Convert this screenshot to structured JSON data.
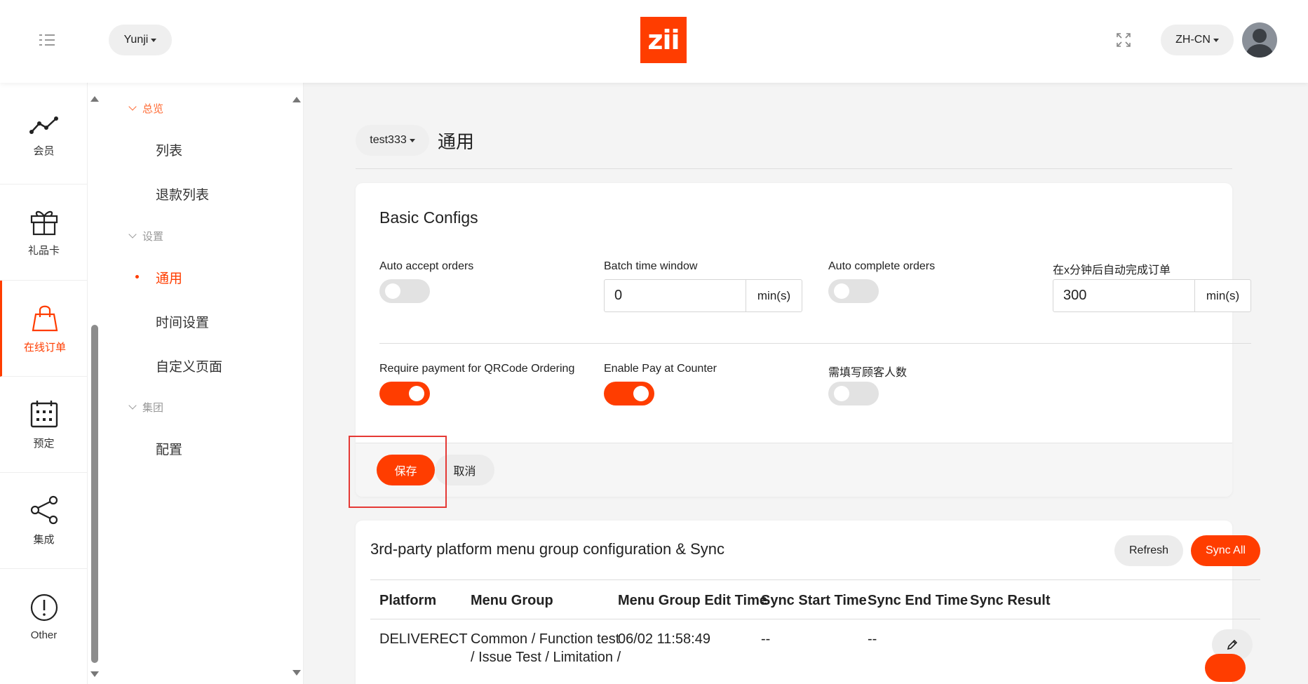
{
  "header": {
    "org_selector": "Yunji",
    "logo_text": "zii",
    "language": "ZH-CN"
  },
  "rail": {
    "items": [
      {
        "label": "会员",
        "icon": "trend-line-icon"
      },
      {
        "label": "礼品卡",
        "icon": "gift-icon"
      },
      {
        "label": "在线订单",
        "icon": "shopping-bag-icon"
      },
      {
        "label": "预定",
        "icon": "calendar-icon"
      },
      {
        "label": "集成",
        "icon": "share-icon"
      },
      {
        "label": "Other",
        "icon": "exclamation-circle-icon"
      }
    ],
    "active_index": 2
  },
  "submenu": {
    "groups": [
      {
        "label": "总览",
        "items": [
          "列表",
          "退款列表"
        ]
      },
      {
        "label": "设置",
        "items": [
          "通用",
          "时间设置",
          "自定义页面"
        ]
      },
      {
        "label": "集团",
        "items": [
          "配置"
        ]
      }
    ],
    "active_item": "通用"
  },
  "page": {
    "store_selector": "test333",
    "title": "通用"
  },
  "basic_configs": {
    "title": "Basic Configs",
    "fields": {
      "auto_accept": {
        "label": "Auto accept orders",
        "on": false
      },
      "batch_window": {
        "label": "Batch time window",
        "value": "0",
        "unit": "min(s)"
      },
      "auto_complete": {
        "label": "Auto complete orders",
        "on": false
      },
      "complete_after": {
        "label": "在x分钟后自动完成订单",
        "value": "300",
        "unit": "min(s)"
      },
      "require_payment": {
        "label": "Require payment for QRCode Ordering",
        "on": true
      },
      "pay_at_counter": {
        "label": "Enable Pay at Counter",
        "on": true
      },
      "guest_count": {
        "label": "需填写顾客人数",
        "on": false
      }
    },
    "save_label": "保存",
    "cancel_label": "取消"
  },
  "sync": {
    "title": "3rd-party platform menu group configuration & Sync",
    "refresh_label": "Refresh",
    "sync_all_label": "Sync All",
    "columns": [
      "Platform",
      "Menu Group",
      "Menu Group Edit Time",
      "Sync Start Time",
      "Sync End Time",
      "Sync Result"
    ],
    "rows": [
      {
        "platform": "DELIVERECT",
        "menu_group_line1": "Common / Function test",
        "menu_group_line2": "/ Issue Test / Limitation /",
        "edit_time": "06/02 11:58:49",
        "sync_start": "--",
        "sync_end": "--",
        "sync_result": ""
      }
    ]
  },
  "colors": {
    "accent": "#ff3d00",
    "highlight_box": "#e53935",
    "toggle_off": "#e2e2e2"
  }
}
